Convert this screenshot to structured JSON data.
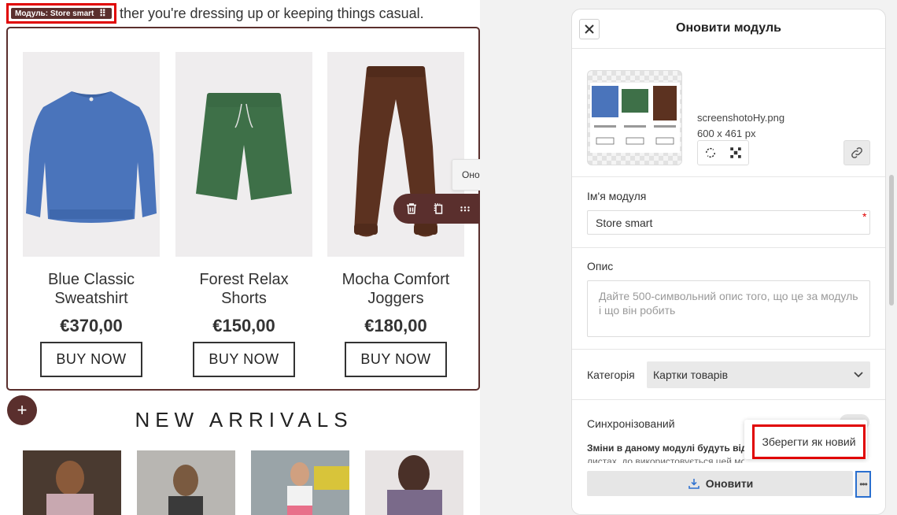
{
  "canvas": {
    "intro_text": "ther you're dressing up or keeping things casual.",
    "module_badge": "Модуль: Store smart",
    "toolbar_tooltip": "Оновити модуль",
    "section_title": "NEW ARRIVALS",
    "add_label": "+",
    "products": [
      {
        "name_line1": "Blue Classic",
        "name_line2": "Sweatshirt",
        "price": "€370,00",
        "button": "BUY NOW",
        "color": "#4a74bb"
      },
      {
        "name_line1": "Forest Relax",
        "name_line2": "Shorts",
        "price": "€150,00",
        "button": "BUY NOW",
        "color": "#3e7048"
      },
      {
        "name_line1": "Mocha Comfort",
        "name_line2": "Joggers",
        "price": "€180,00",
        "button": "BUY NOW",
        "color": "#5c3220"
      }
    ]
  },
  "panel": {
    "title": "Оновити модуль",
    "file_name": "screenshotoHy.png",
    "file_dims": "600 x 461 px",
    "name_label": "Ім'я модуля",
    "name_value": "Store smart",
    "required_mark": "*",
    "description_label": "Опис",
    "description_placeholder": "Дайте 500-символьний опис того, що це за модуль і що він робить",
    "category_label": "Категорія",
    "category_value": "Картки товарів",
    "synced_label": "Синхронізований",
    "sync_note_line1": "Зміни в даному модулі будуть відоб",
    "sync_note_line2": "листах, до використовується цей мо",
    "save_as_new": "Зберегти як новий",
    "update_button": "Оновити"
  },
  "colors": {
    "brand": "#5a2f2d",
    "highlight": "#e00000",
    "focus": "#2a6fcf"
  },
  "icons": [
    "close-icon",
    "trash-icon",
    "duplicate-icon",
    "drag-handle-icon",
    "sync-icon",
    "replace-image-icon",
    "crop-icon",
    "link-icon",
    "download-icon",
    "more-icon",
    "chevron-down-icon",
    "plus-icon"
  ]
}
